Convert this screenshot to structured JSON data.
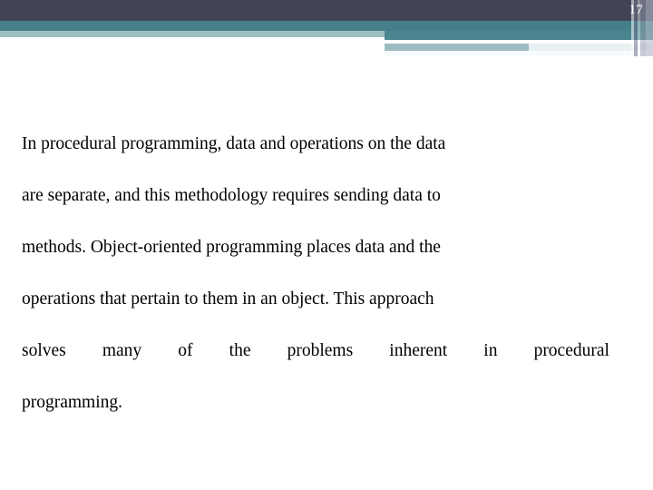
{
  "slide": {
    "page_number": "17",
    "colors": {
      "band_dark": "#424456",
      "band_teal": "#45808a",
      "band_light": "#9dbcc2",
      "band_pale": "#e8f1f2",
      "text": "#000000",
      "background": "#ffffff"
    },
    "body_lines": [
      "In procedural programming, data and operations on the data",
      "are separate, and this methodology requires sending data to",
      "methods. Object-oriented programming places data and the",
      "operations that pertain to them in an object. This approach",
      "programming."
    ],
    "justified_line_words": [
      "solves",
      "many",
      "of",
      "the",
      "problems",
      "inherent",
      "in",
      "procedural"
    ],
    "full_paragraph": "In procedural programming, data and operations on the data are separate, and this methodology requires sending data to methods. Object-oriented programming places data and the operations that pertain to them in an object. This approach solves many of the problems inherent in procedural programming."
  }
}
